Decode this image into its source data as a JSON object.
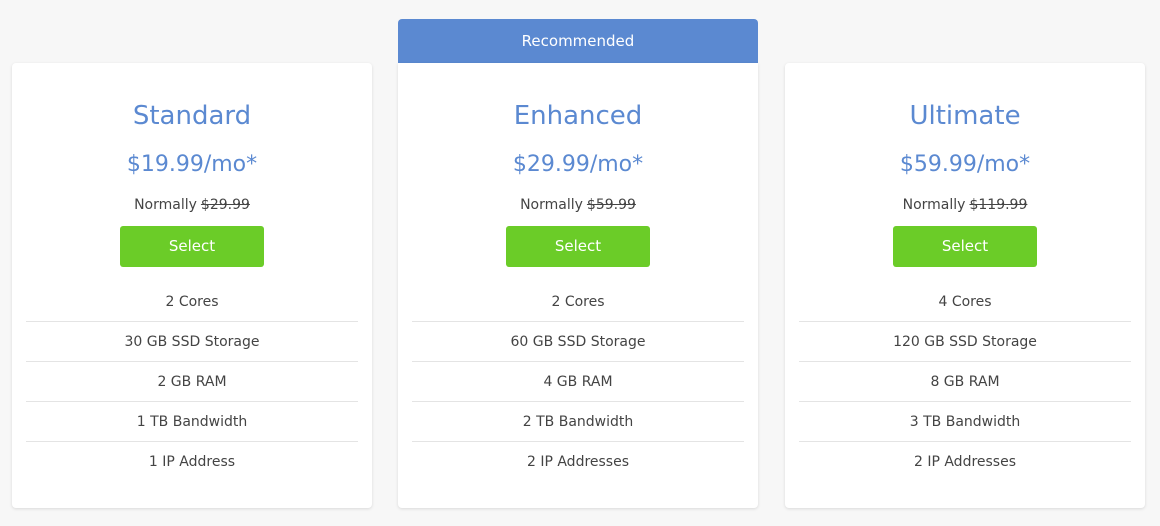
{
  "recommended_label": "Recommended",
  "normally_label": "Normally",
  "colors": {
    "accent": "#5b89d1",
    "button": "#6bcc28",
    "background": "#f7f7f7"
  },
  "plans": [
    {
      "name": "Standard",
      "price": "$19.99/mo*",
      "old_price": "$29.99",
      "select_label": "Select",
      "features": [
        "2 Cores",
        "30 GB SSD Storage",
        "2 GB RAM",
        "1 TB Bandwidth",
        "1 IP Address"
      ]
    },
    {
      "name": "Enhanced",
      "price": "$29.99/mo*",
      "old_price": "$59.99",
      "select_label": "Select",
      "features": [
        "2 Cores",
        "60 GB SSD Storage",
        "4 GB RAM",
        "2 TB Bandwidth",
        "2 IP Addresses"
      ]
    },
    {
      "name": "Ultimate",
      "price": "$59.99/mo*",
      "old_price": "$119.99",
      "select_label": "Select",
      "features": [
        "4 Cores",
        "120 GB SSD Storage",
        "8 GB RAM",
        "3 TB Bandwidth",
        "2 IP Addresses"
      ]
    }
  ]
}
